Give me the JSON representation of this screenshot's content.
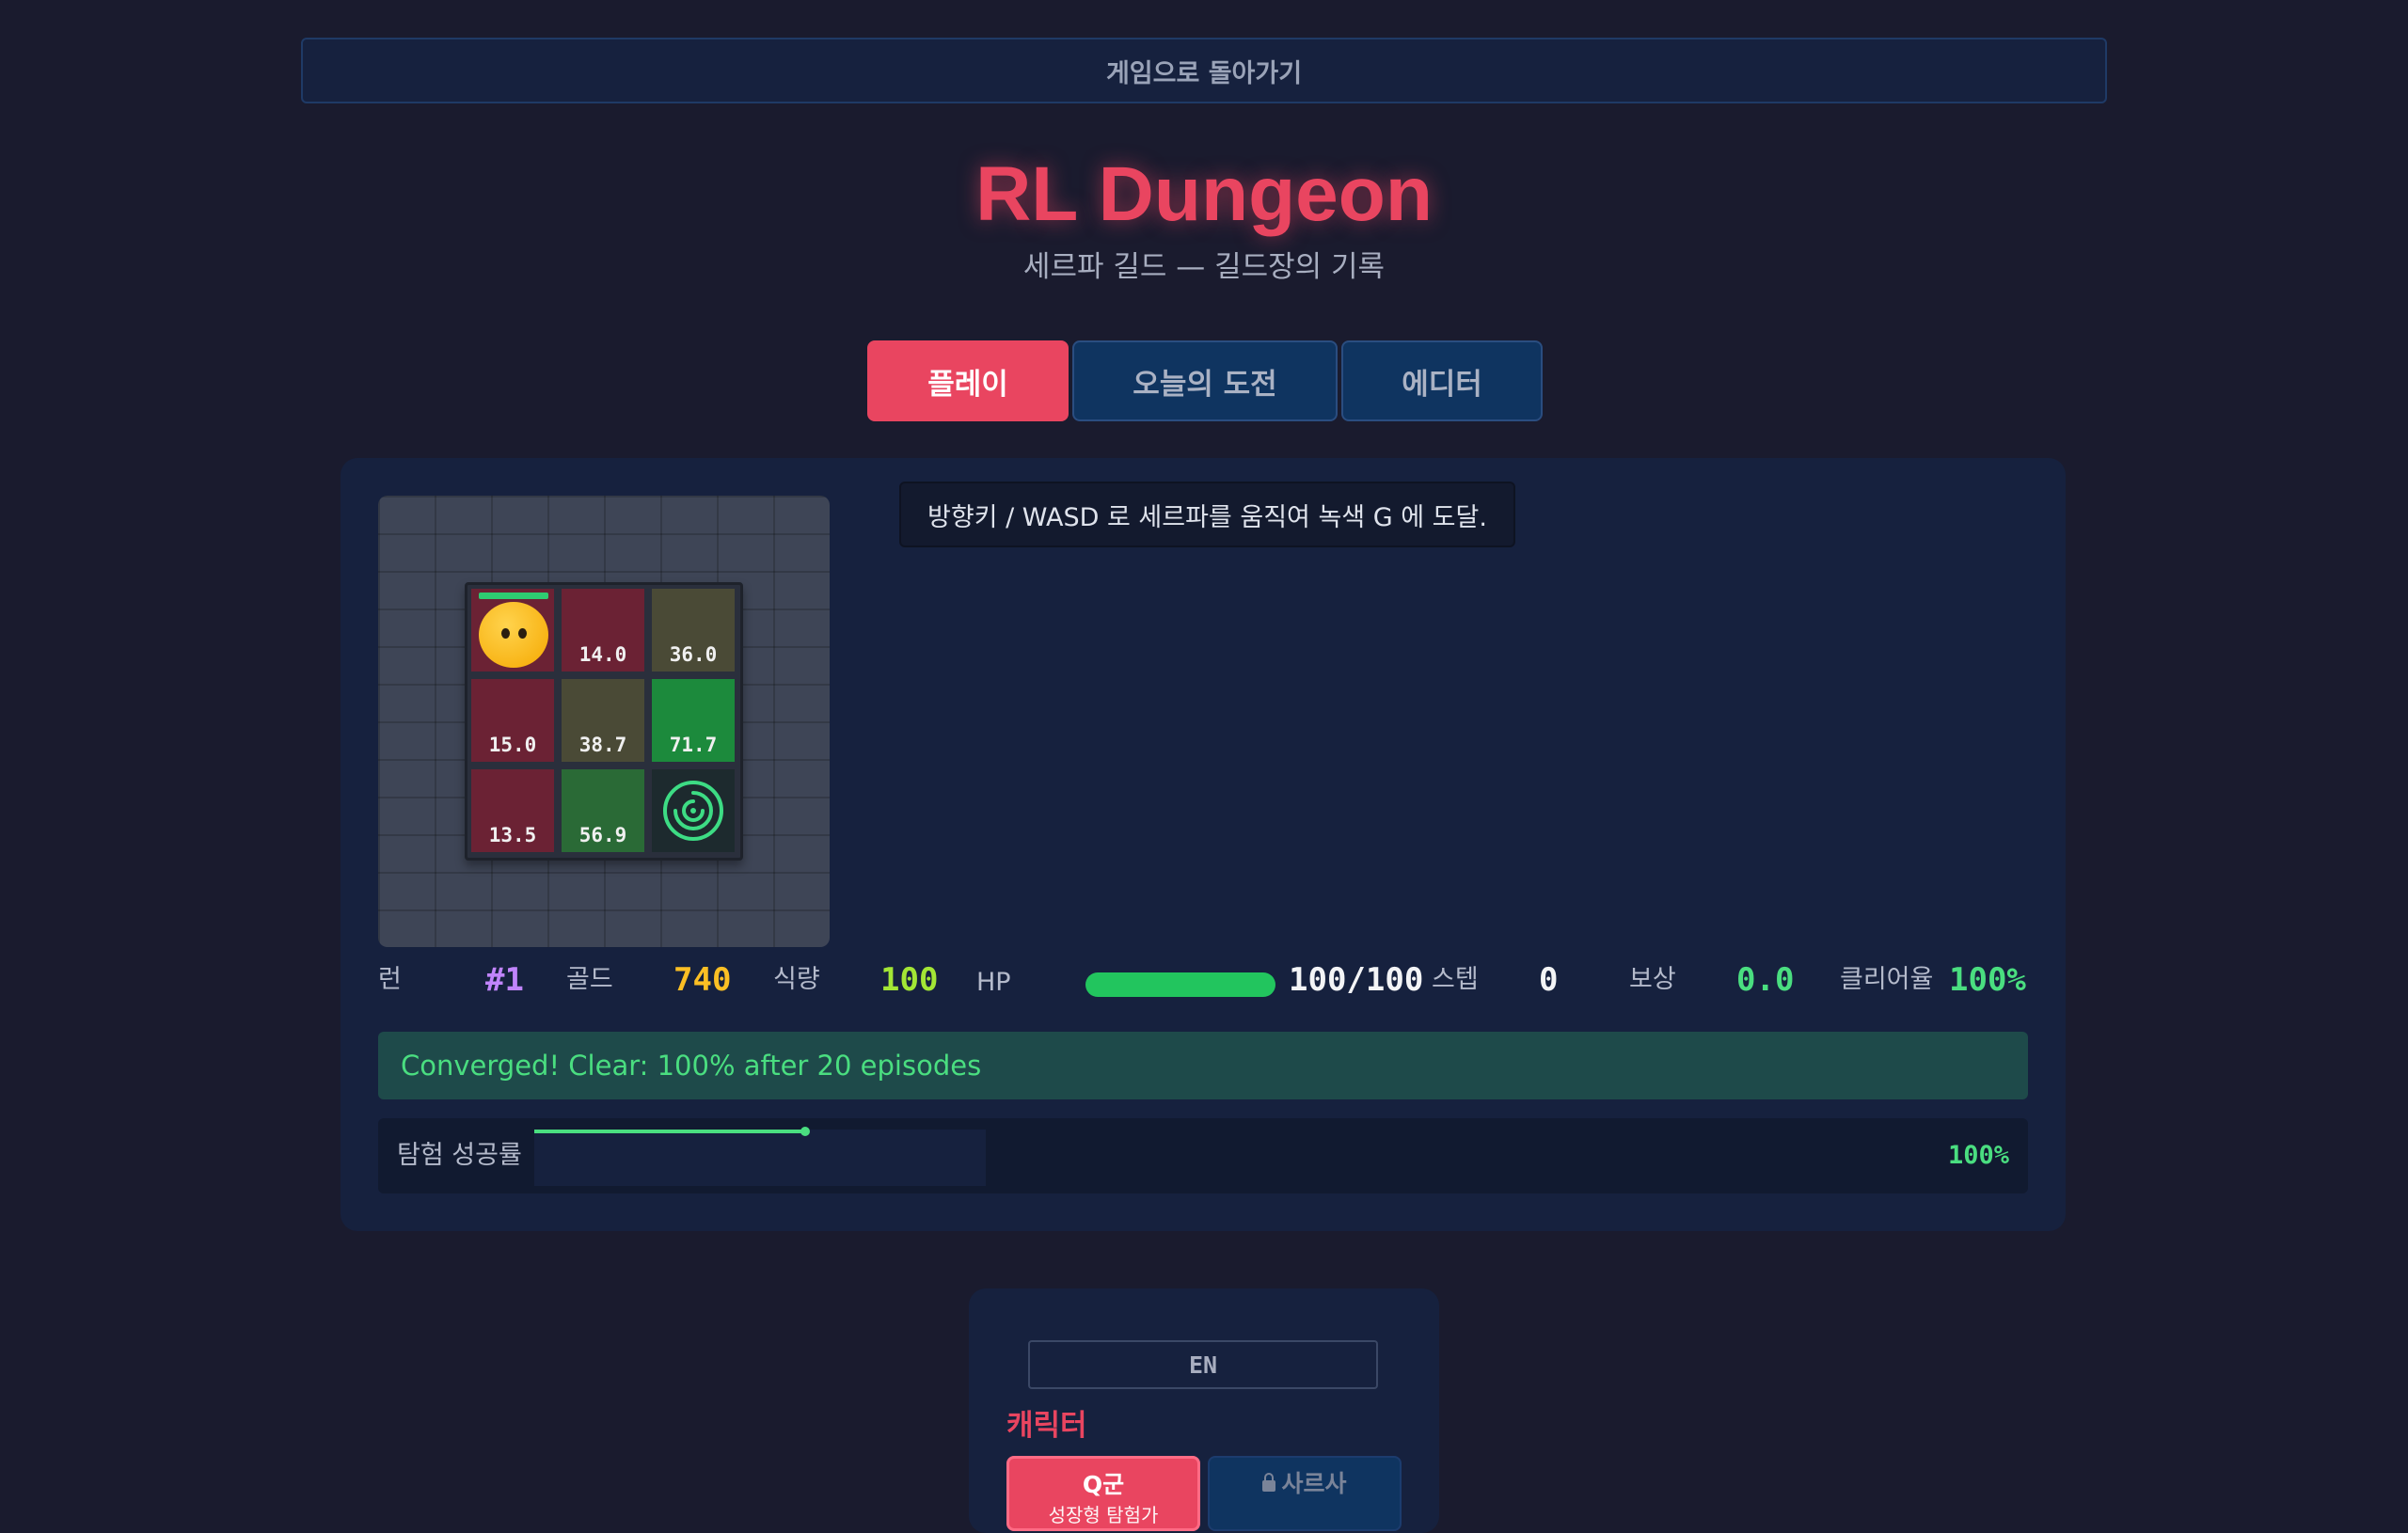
{
  "back_button": "게임으로 돌아가기",
  "header": {
    "title": "RL Dungeon",
    "subtitle": "세르파 길드 — 길드장의 기록"
  },
  "tabs": [
    {
      "label": "플레이",
      "active": true
    },
    {
      "label": "오늘의 도전",
      "active": false
    },
    {
      "label": "에디터",
      "active": false
    }
  ],
  "hint": "방향키 / WASD 로 세르파를 움직여 녹색 G 에 도달.",
  "grid": {
    "cells": [
      {
        "value": "",
        "kind": "player"
      },
      {
        "value": "14.0",
        "kind": "red"
      },
      {
        "value": "36.0",
        "kind": "olive"
      },
      {
        "value": "15.0",
        "kind": "red"
      },
      {
        "value": "38.7",
        "kind": "olive"
      },
      {
        "value": "71.7",
        "kind": "green"
      },
      {
        "value": "13.5",
        "kind": "red"
      },
      {
        "value": "56.9",
        "kind": "dark-green"
      },
      {
        "value": "",
        "kind": "goal"
      }
    ],
    "player_hp_fraction": 1.0
  },
  "stats": {
    "run_label": "런",
    "run_value": "#1",
    "gold_label": "골드",
    "gold_value": "740",
    "food_label": "식량",
    "food_value": "100",
    "hp_label": "HP",
    "hp_value": "100/100",
    "hp_fraction": 1.0,
    "step_label": "스텝",
    "step_value": "0",
    "reward_label": "보상",
    "reward_value": "0.0",
    "clear_label": "클리어율",
    "clear_value": "100%"
  },
  "colors": {
    "accent": "#e94560",
    "run": "#c084fc",
    "gold": "#fbbf24",
    "food": "#a3e635",
    "hp_text": "#f3f4f6",
    "step": "#f3f4f6",
    "reward": "#4ade80",
    "clear": "#4ade80"
  },
  "banner": "Converged! Clear: 100% after 20 episodes",
  "success_rate": {
    "label": "탐험 성공률",
    "value": "100%",
    "fraction": 1.0
  },
  "side_panel": {
    "language": "EN",
    "character_title": "캐릭터",
    "characters": [
      {
        "name": "Q군",
        "sub": "성장형 탐험가",
        "locked": false
      },
      {
        "name": "사르사",
        "sub": "",
        "locked": true
      }
    ]
  }
}
